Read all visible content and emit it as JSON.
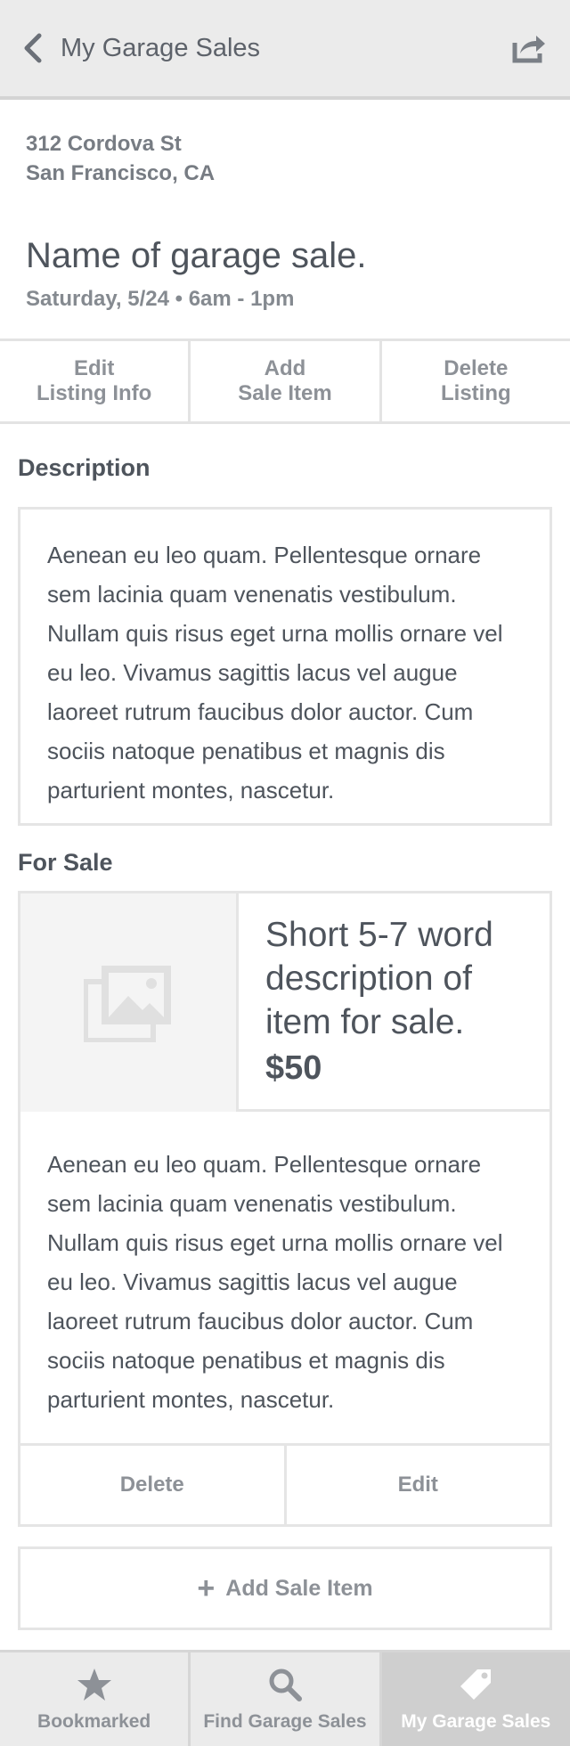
{
  "header": {
    "back_label": "My Garage Sales",
    "back_icon": "chevron-left-icon",
    "share_icon": "share-icon"
  },
  "listing": {
    "address_line1": "312 Cordova St",
    "address_line2": "San Francisco, CA",
    "title": "Name of garage sale.",
    "date": "Saturday, 5/24 • 6am - 1pm"
  },
  "actions": {
    "edit": "Edit\nListing Info",
    "add": "Add\nSale Item",
    "delete": "Delete\nListing"
  },
  "description": {
    "heading": "Description",
    "text": "Aenean eu leo quam. Pellentesque ornare sem lacinia quam venenatis vestibulum. Nullam quis risus eget urna mollis ornare vel eu leo. Vivamus sagittis lacus vel augue laoreet rutrum faucibus dolor auctor. Cum sociis natoque penatibus et magnis dis parturient montes, nascetur."
  },
  "for_sale": {
    "heading": "For Sale",
    "items": [
      {
        "title": "Short 5-7 word description of item for sale.",
        "price": "$50",
        "description": "Aenean eu leo quam. Pellentesque ornare sem lacinia quam venenatis vestibulum. Nullam quis risus eget urna mollis ornare vel eu leo. Vivamus sagittis lacus vel augue laoreet rutrum faucibus dolor auctor. Cum sociis natoque penatibus et magnis dis parturient montes, nascetur.",
        "delete_label": "Delete",
        "edit_label": "Edit"
      }
    ],
    "add_label": "Add Sale Item"
  },
  "tabs": [
    {
      "label": "Bookmarked",
      "icon": "star-icon",
      "active": false
    },
    {
      "label": "Find Garage Sales",
      "icon": "search-icon",
      "active": false
    },
    {
      "label": "My Garage Sales",
      "icon": "tag-icon",
      "active": true
    }
  ],
  "colors": {
    "header_bg": "#ebebeb",
    "text_dark": "#4e545c",
    "text_muted": "#8d9197",
    "border": "#e5e5e5",
    "tab_active_bg": "#cfcfcf"
  }
}
